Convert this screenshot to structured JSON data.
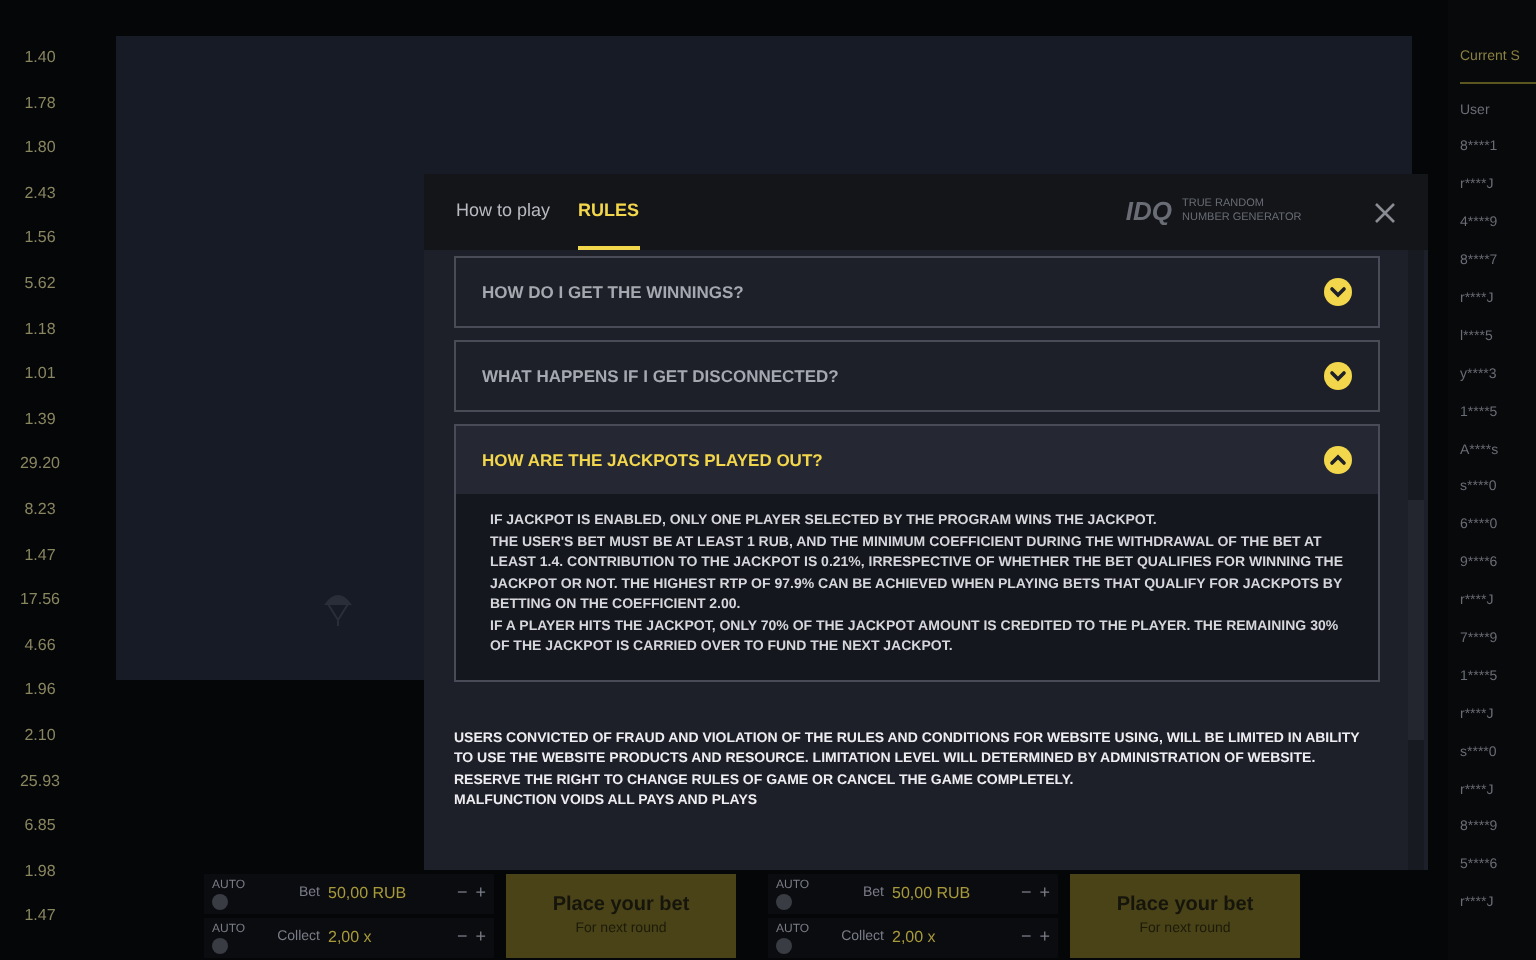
{
  "history": [
    "1.40",
    "1.78",
    "1.80",
    "2.43",
    "1.56",
    "5.62",
    "1.18",
    "1.01",
    "1.39",
    "29.20",
    "8.23",
    "1.47",
    "17.56",
    "4.66",
    "1.96",
    "2.10",
    "25.93",
    "6.85",
    "1.98",
    "1.47"
  ],
  "side_panel": {
    "tab": "Current S",
    "column": "User",
    "users": [
      "8****1",
      "r****J",
      "4****9",
      "8****7",
      "r****J",
      "l****5",
      "y****3",
      "1****5",
      "A****s",
      "s****0",
      "6****0",
      "9****6",
      "r****J",
      "7****9",
      "1****5",
      "r****J",
      "s****0",
      "r****J",
      "8****9",
      "5****6",
      "r****J"
    ]
  },
  "bet_panels": [
    {
      "auto_labels": [
        "AUTO",
        "AUTO"
      ],
      "bet_label": "Bet",
      "bet_value": "50,00 RUB",
      "collect_label": "Collect",
      "collect_value": "2,00 x",
      "minus": "−",
      "plus": "+",
      "button_title": "Place your bet",
      "button_subtitle": "For next round"
    },
    {
      "auto_labels": [
        "AUTO",
        "AUTO"
      ],
      "bet_label": "Bet",
      "bet_value": "50,00 RUB",
      "collect_label": "Collect",
      "collect_value": "2,00 x",
      "minus": "−",
      "plus": "+",
      "button_title": "Place your bet",
      "button_subtitle": "For next round"
    }
  ],
  "modal": {
    "tabs": [
      {
        "label": "How to play",
        "selected": false
      },
      {
        "label": "RULES",
        "selected": true
      }
    ],
    "logo": {
      "mark": "IDQ",
      "caption": "TRUE RANDOM NUMBER GENERATOR"
    },
    "faq": [
      {
        "question": "HOW DO I GET THE WINNINGS?",
        "expanded": false
      },
      {
        "question": "WHAT HAPPENS IF I GET DISCONNECTED?",
        "expanded": false
      },
      {
        "question": "HOW ARE THE JACKPOTS PLAYED OUT?",
        "expanded": true,
        "answer": [
          "IF JACKPOT IS ENABLED, ONLY ONE PLAYER SELECTED BY THE PROGRAM WINS THE JACKPOT.",
          "THE USER'S BET MUST BE AT LEAST 1 RUB, AND THE MINIMUM COEFFICIENT DURING THE WITHDRAWAL OF THE BET AT LEAST 1.4. CONTRIBUTION TO THE JACKPOT IS 0.21%, IRRESPECTIVE OF WHETHER THE BET QUALIFIES FOR WINNING THE JACKPOT OR NOT. THE HIGHEST RTP OF 97.9% CAN BE ACHIEVED WHEN PLAYING BETS THAT QUALIFY FOR JACKPOTS BY BETTING ON THE COEFFICIENT 2.00.",
          "IF A PLAYER HITS THE JACKPOT, ONLY 70% OF THE JACKPOT AMOUNT IS CREDITED TO THE PLAYER. THE REMAINING 30% OF THE JACKPOT IS CARRIED OVER TO FUND THE NEXT JACKPOT."
        ]
      }
    ],
    "footer": [
      "USERS CONVICTED OF FRAUD AND VIOLATION OF THE RULES AND CONDITIONS FOR WEBSITE USING, WILL BE LIMITED IN ABILITY TO USE THE WEBSITE PRODUCTS AND RESOURCE. LIMITATION LEVEL WILL DETERMINED BY ADMINISTRATION OF WEBSITE. RESERVE THE RIGHT TO CHANGE RULES OF GAME OR CANCEL THE GAME COMPLETELY.",
      "MALFUNCTION VOIDS ALL PAYS AND PLAYS"
    ]
  }
}
